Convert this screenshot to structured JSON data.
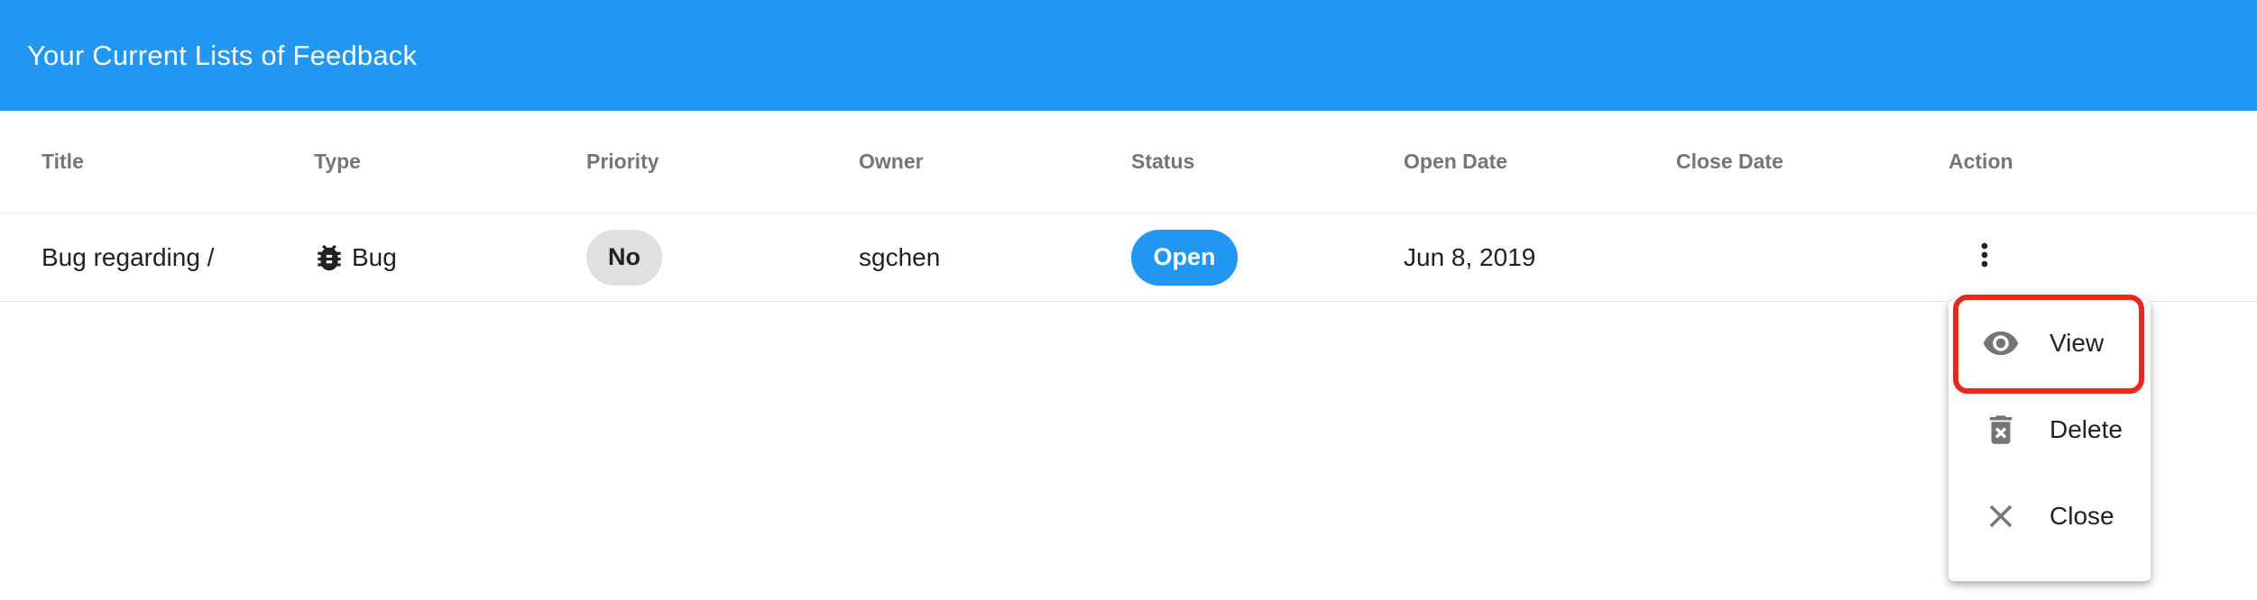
{
  "app_bar": {
    "title": "Your Current Lists of Feedback",
    "color": "#2196f3"
  },
  "table": {
    "columns": [
      "Title",
      "Type",
      "Priority",
      "Owner",
      "Status",
      "Open Date",
      "Close Date",
      "Action"
    ],
    "rows": [
      {
        "title": "Bug regarding /",
        "type": "Bug",
        "type_icon": "bug-icon",
        "priority": "No",
        "owner": "sgchen",
        "status": "Open",
        "open_date": "Jun 8, 2019",
        "close_date": "",
        "action_icon": "more-vert-icon"
      }
    ]
  },
  "action_menu": {
    "items": [
      {
        "label": "View",
        "icon": "eye-icon"
      },
      {
        "label": "Delete",
        "icon": "trash-icon"
      },
      {
        "label": "Close",
        "icon": "close-icon"
      }
    ],
    "highlighted": "View",
    "highlight_color": "#e8281e"
  },
  "colors": {
    "status_open": "#2196f3",
    "priority_chip": "#e0e0e0"
  }
}
